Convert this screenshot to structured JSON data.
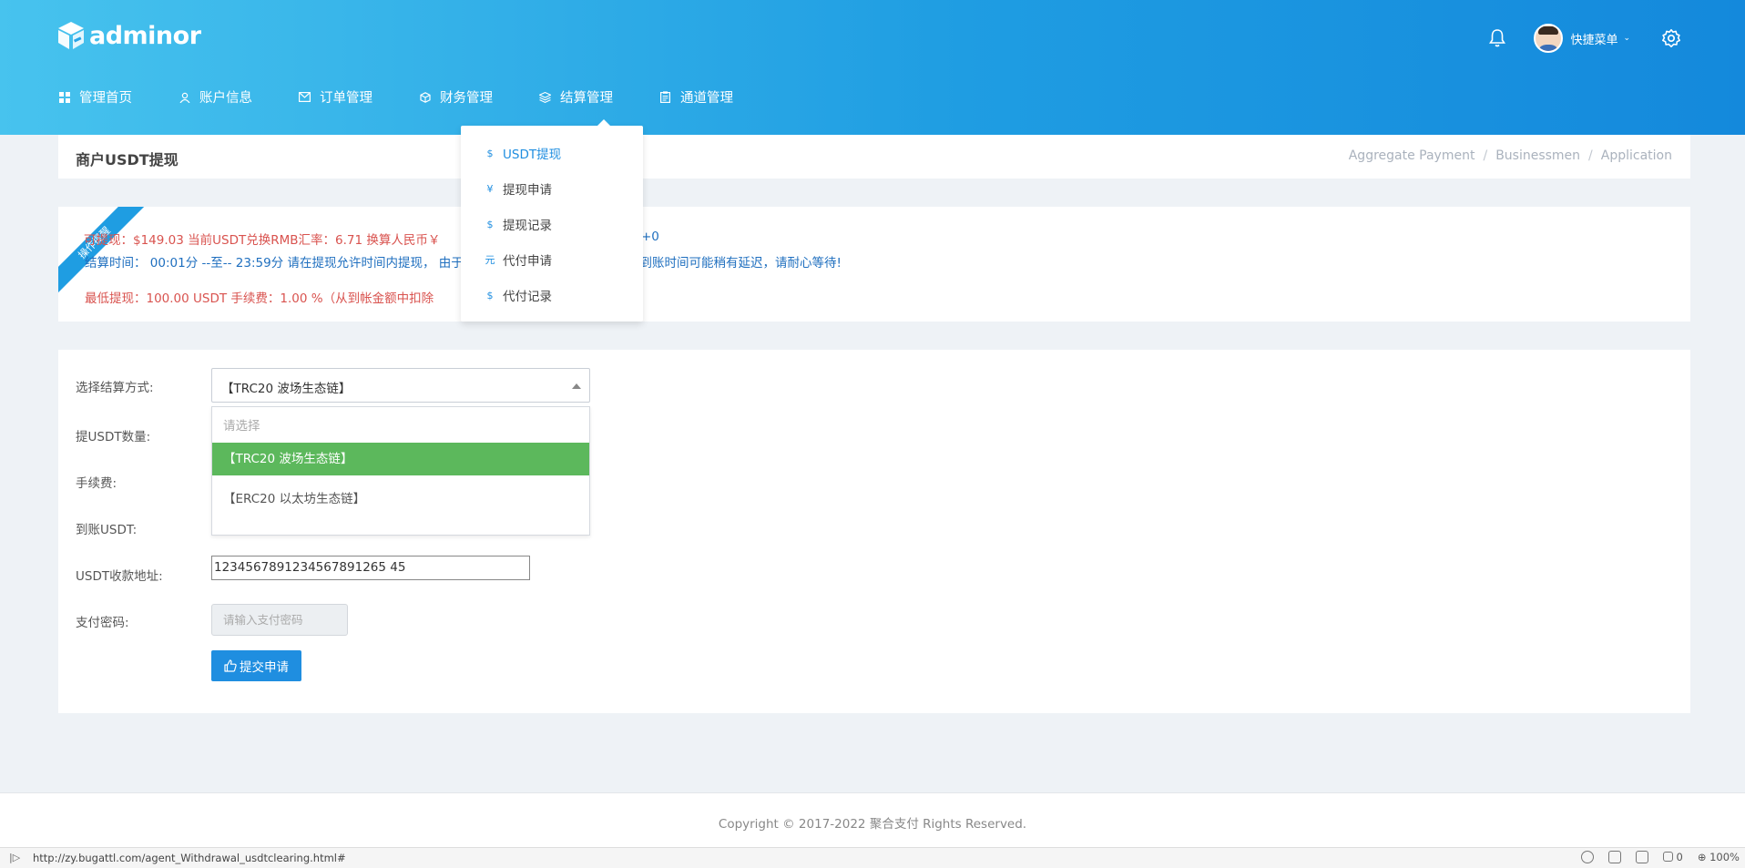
{
  "app": {
    "logo_text": "adminor"
  },
  "nav": {
    "items": [
      {
        "label": "管理首页",
        "icon": "dashboard-icon"
      },
      {
        "label": "账户信息",
        "icon": "user-icon"
      },
      {
        "label": "订单管理",
        "icon": "mail-icon"
      },
      {
        "label": "财务管理",
        "icon": "box-icon"
      },
      {
        "label": "结算管理",
        "icon": "layers-icon"
      },
      {
        "label": "通道管理",
        "icon": "clipboard-icon"
      }
    ]
  },
  "header": {
    "quick_menu": "快捷菜单"
  },
  "settlement_menu": {
    "items": [
      {
        "label": "USDT提现",
        "glyph": "$"
      },
      {
        "label": "提现申请",
        "glyph": "¥"
      },
      {
        "label": "提现记录",
        "glyph": "$"
      },
      {
        "label": "代付申请",
        "glyph": "元"
      },
      {
        "label": "代付记录",
        "glyph": "$"
      }
    ]
  },
  "page": {
    "title": "商户USDT提现",
    "breadcrumb": [
      "Aggregate Payment",
      "Businessmen",
      "Application"
    ]
  },
  "notice": {
    "ribbon": "操作提醒",
    "line1": "可提现：$149.03  当前USDT兑换RMB汇率：6.71  换算人民币￥",
    "line1_tail": "+0",
    "line2": "结算时间：  00:01分 --至-- 23:59分 请在提现允许时间内提现，  由于",
    "line2_tail": "，到账时间可能稍有延迟，请耐心等待!",
    "line3": "最低提现：100.00 USDT      手续费：1.00 %（从到帐金额中扣除"
  },
  "form": {
    "method_label": "选择结算方式:",
    "method_value": "【TRC20 波场生态链】",
    "options": [
      "请选择",
      "【TRC20 波场生态链】",
      "【ERC20 以太坊生态链】"
    ],
    "amount_label": "提USDT数量:",
    "fee_label": "手续费:",
    "arrival_label": "到账USDT:",
    "address_label": "USDT收款地址:",
    "address_value": "1234567891234567891265 45",
    "password_label": "支付密码:",
    "password_placeholder": "请输入支付密码",
    "submit_label": "提交申请"
  },
  "footer": {
    "copyright": "Copyright © 2017-2022 聚合支付 Rights Reserved."
  },
  "statusbar": {
    "url": "http://zy.bugattl.com/agent_Withdrawal_usdtclearing.html#",
    "count": "0",
    "zoom": "100%"
  },
  "colors": {
    "header_start": "#47c3ee",
    "header_end": "#1489dc",
    "accent": "#1f8ee0",
    "selected_option": "#5cb85c",
    "warning": "#d9534f"
  }
}
